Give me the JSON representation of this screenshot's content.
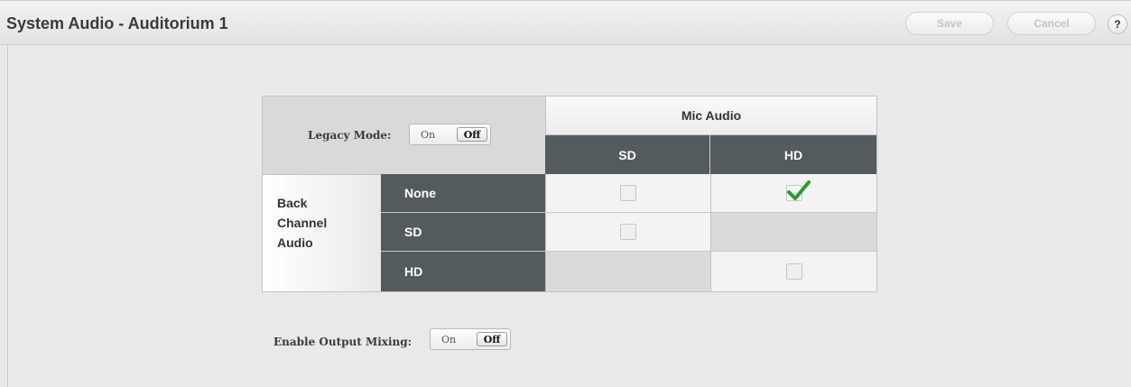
{
  "header": {
    "title": "System Audio - Auditorium 1",
    "save_label": "Save",
    "cancel_label": "Cancel",
    "help_label": "?"
  },
  "legacy_mode": {
    "label": "Legacy Mode:",
    "on_label": "On",
    "off_label": "Off",
    "selected": "Off"
  },
  "matrix": {
    "column_group_title": "Mic Audio",
    "columns": [
      "SD",
      "HD"
    ],
    "row_group_title_lines": [
      "Back",
      "Channel",
      "Audio"
    ],
    "rows": [
      {
        "label": "None",
        "cells": [
          "unchecked",
          "checked"
        ]
      },
      {
        "label": "SD",
        "cells": [
          "unchecked",
          "unavailable"
        ]
      },
      {
        "label": "HD",
        "cells": [
          "unavailable",
          "unchecked"
        ]
      }
    ]
  },
  "output_mixing": {
    "label": "Enable Output Mixing:",
    "on_label": "On",
    "off_label": "Off",
    "selected": "Off"
  },
  "colors": {
    "header_dark": "#535b5e",
    "check_green": "#2e9a2e"
  }
}
